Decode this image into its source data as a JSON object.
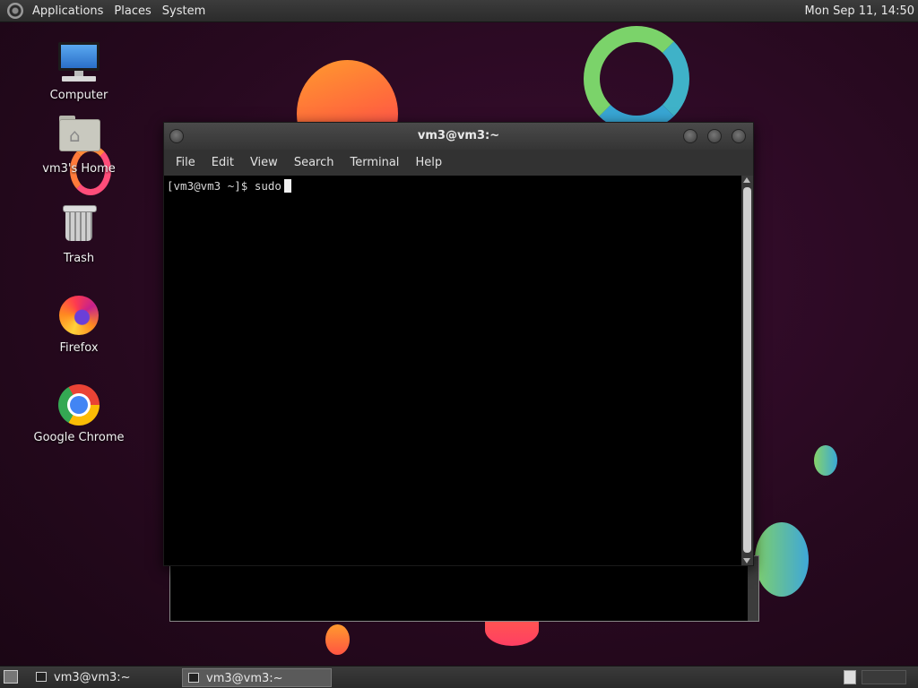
{
  "top_panel": {
    "menus": [
      "Applications",
      "Places",
      "System"
    ],
    "clock": "Mon Sep 11, 14:50"
  },
  "desktop": {
    "icons": [
      {
        "label": "Computer",
        "icon": "computer-icon"
      },
      {
        "label": "vm3's Home",
        "icon": "home-folder-icon"
      },
      {
        "label": "Trash",
        "icon": "trash-icon"
      },
      {
        "label": "Firefox",
        "icon": "firefox-icon"
      },
      {
        "label": "Google Chrome",
        "icon": "chrome-icon"
      }
    ]
  },
  "terminal": {
    "title": "vm3@vm3:~",
    "menu": [
      "File",
      "Edit",
      "View",
      "Search",
      "Terminal",
      "Help"
    ],
    "prompt": "[vm3@vm3 ~]$ sudo"
  },
  "taskbar": {
    "tasks": [
      {
        "label": "vm3@vm3:~",
        "active": false
      },
      {
        "label": "vm3@vm3:~",
        "active": true
      }
    ]
  },
  "colors": {
    "wallpaper": "#27091f",
    "panel": "#2b2b2b",
    "terminal_bg": "#000000"
  }
}
